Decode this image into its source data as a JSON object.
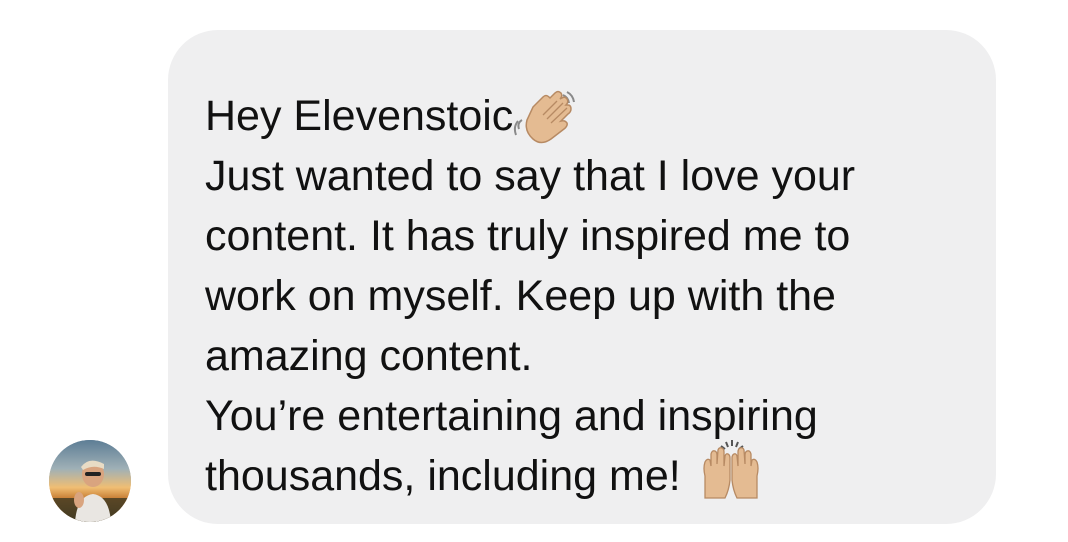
{
  "message": {
    "lines": [
      "Hey Elevenstoic",
      "Just wanted to say that I love your",
      "content. It has truly inspired me to",
      "work on myself. Keep up with the",
      "amazing content.",
      "You’re entertaining and inspiring",
      "thousands, including me!"
    ],
    "emojis": [
      "waving-hand-emoji",
      "raising-hands-emoji"
    ]
  },
  "colors": {
    "bubble_background": "#efeff0",
    "text": "#111111",
    "page_background": "#ffffff"
  }
}
